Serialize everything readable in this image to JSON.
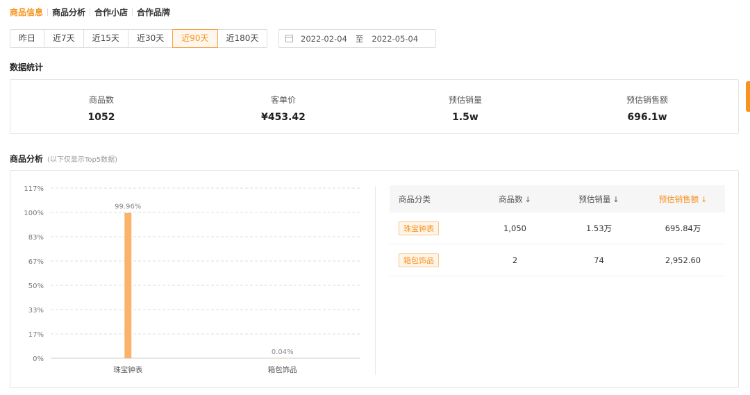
{
  "top_tabs": [
    {
      "label": "商品信息",
      "active": true
    },
    {
      "label": "商品分析",
      "active": false
    },
    {
      "label": "合作小店",
      "active": false
    },
    {
      "label": "合作品牌",
      "active": false
    }
  ],
  "range_buttons": [
    {
      "label": "昨日",
      "active": false
    },
    {
      "label": "近7天",
      "active": false
    },
    {
      "label": "近15天",
      "active": false
    },
    {
      "label": "近30天",
      "active": false
    },
    {
      "label": "近90天",
      "active": true
    },
    {
      "label": "近180天",
      "active": false
    }
  ],
  "date_range": {
    "start": "2022-02-04",
    "separator": "至",
    "end": "2022-05-04",
    "icon": "calendar-icon"
  },
  "stats": {
    "title": "数据统计",
    "items": [
      {
        "label": "商品数",
        "value": "1052"
      },
      {
        "label": "客单价",
        "value": "¥453.42"
      },
      {
        "label": "预估销量",
        "value": "1.5w"
      },
      {
        "label": "预估销售额",
        "value": "696.1w"
      }
    ]
  },
  "analysis": {
    "title": "商品分析",
    "subtitle": "(以下仅显示Top5数据)"
  },
  "chart_data": {
    "type": "bar",
    "categories": [
      "珠宝钟表",
      "箱包饰品"
    ],
    "values": [
      99.96,
      0.04
    ],
    "data_labels": [
      "99.96%",
      "0.04%"
    ],
    "yticks": [
      "0%",
      "17%",
      "33%",
      "50%",
      "67%",
      "83%",
      "100%",
      "117%"
    ],
    "ylim": [
      0,
      117
    ],
    "grid": true,
    "bar_color": "#f9b36b"
  },
  "table": {
    "headers": [
      {
        "label": "商品分类",
        "sortable": false
      },
      {
        "label": "商品数",
        "sortable": true
      },
      {
        "label": "预估销量",
        "sortable": true
      },
      {
        "label": "预估销售额",
        "sortable": true,
        "active": true
      }
    ],
    "sort_icon": "↓",
    "rows": [
      {
        "category": "珠宝钟表",
        "count": "1,050",
        "sales": "1.53万",
        "revenue": "695.84万"
      },
      {
        "category": "箱包饰品",
        "count": "2",
        "sales": "74",
        "revenue": "2,952.60"
      }
    ]
  },
  "colors": {
    "accent": "#f7931e",
    "bar": "#f9b36b",
    "border": "#e6e6e6"
  }
}
